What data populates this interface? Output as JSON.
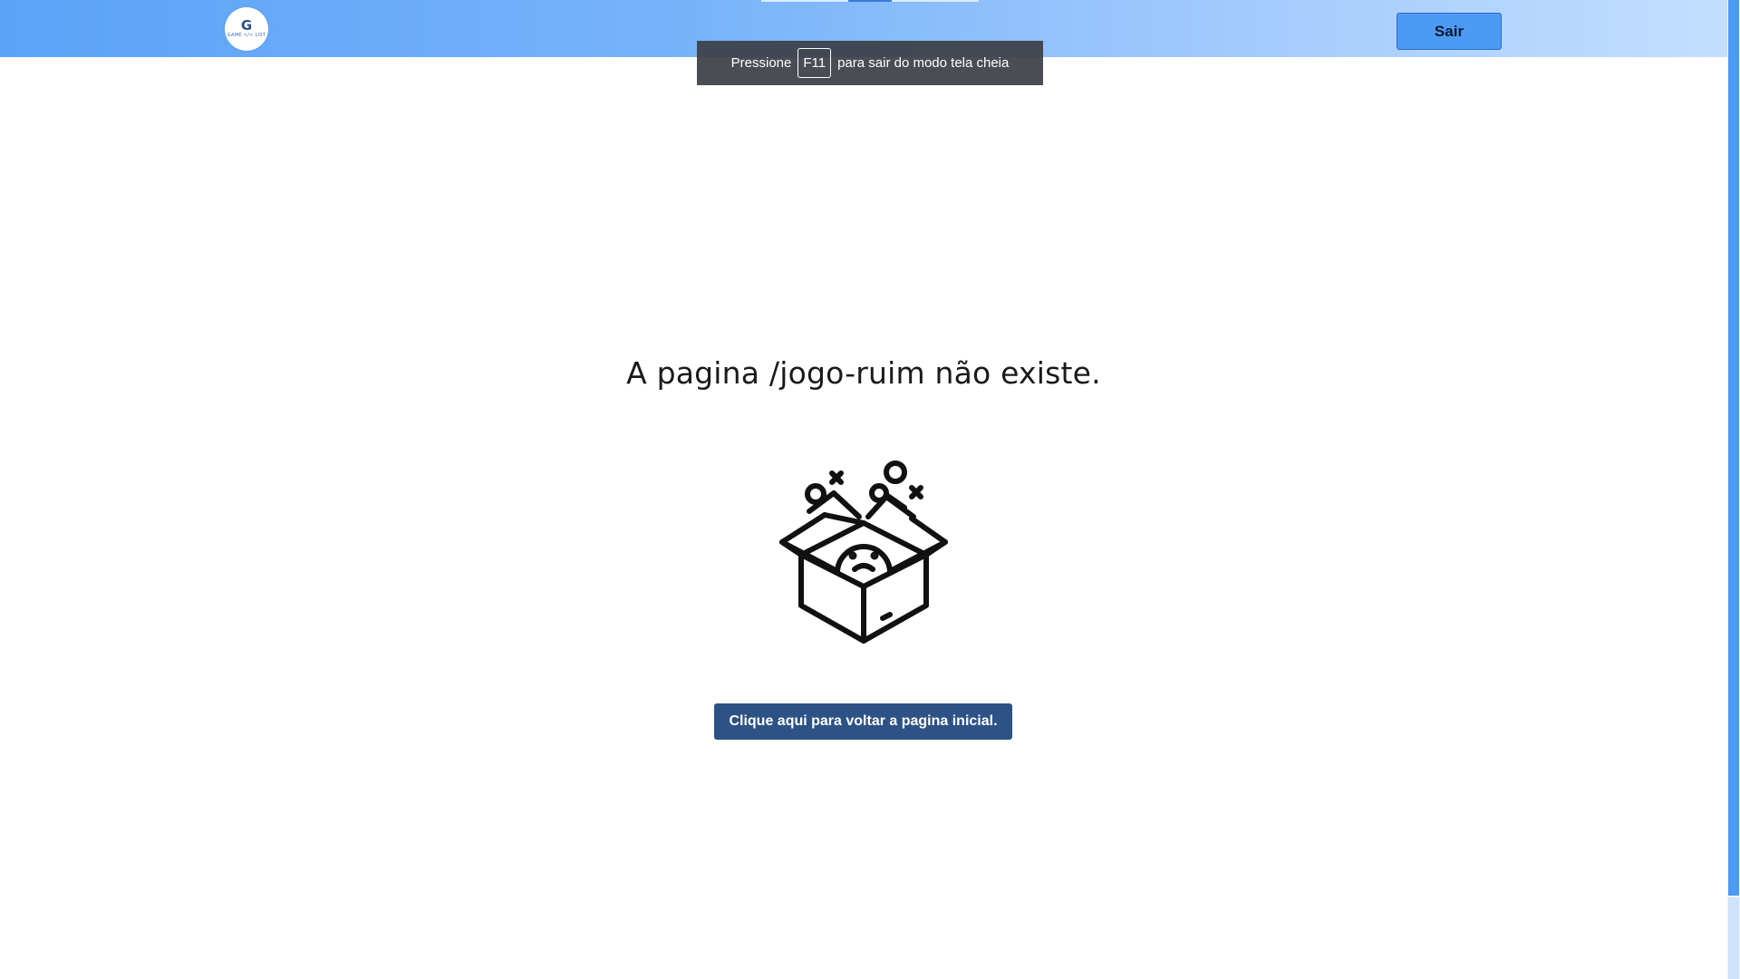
{
  "header": {
    "logo": {
      "mark": "G",
      "text": "GAME </> LIST"
    },
    "exit_button_label": "Sair",
    "background_colors": [
      "#5aa3f7",
      "#c4defe"
    ]
  },
  "fullscreen_notice": {
    "before": "Pressione",
    "key": "F11",
    "after": "para sair do modo tela cheia"
  },
  "main": {
    "error_message": "A pagina /jogo-ruim não existe.",
    "illustration_icon": "empty-box-sad-face-icon",
    "home_link_label": "Clique aqui para voltar a pagina inicial."
  },
  "colors": {
    "accent": "#4d9af5",
    "link_button": "#2d5286",
    "text": "#1a1a1a"
  }
}
